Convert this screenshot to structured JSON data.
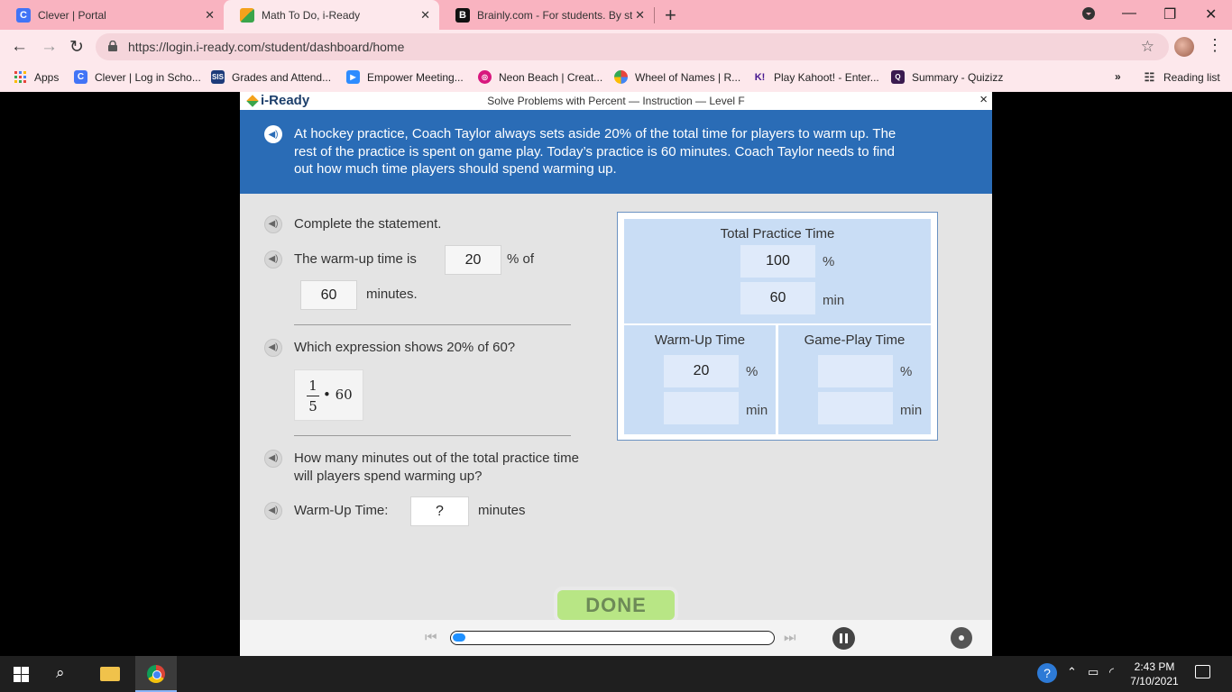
{
  "browser": {
    "tabs": [
      {
        "title": "Clever | Portal",
        "icon": "C",
        "color": "#4274f6"
      },
      {
        "title": "Math To Do, i-Ready",
        "icon": "iready-gem",
        "color": "#f4a21c"
      },
      {
        "title": "Brainly.com - For students. By stu",
        "icon": "B",
        "color": "#111111"
      }
    ],
    "url": "https://login.i-ready.com/student/dashboard/home",
    "bookmarks": [
      {
        "label": "Apps",
        "icon": "apps-grid"
      },
      {
        "label": "Clever | Log in Scho...",
        "icon": "C"
      },
      {
        "label": "Grades and Attend...",
        "icon": "SIS"
      },
      {
        "label": "Empower Meeting...",
        "icon": "video"
      },
      {
        "label": "Neon Beach | Creat...",
        "icon": "neon"
      },
      {
        "label": "Wheel of Names | R...",
        "icon": "wheel"
      },
      {
        "label": "Play Kahoot! - Enter...",
        "icon": "K!"
      },
      {
        "label": "Summary - Quizizz",
        "icon": "Q"
      }
    ],
    "reading_list": "Reading list"
  },
  "app": {
    "logo": "i-Ready",
    "lesson_title": "Solve Problems with Percent — Instruction — Level F",
    "close": "×",
    "problem": "At hockey practice, Coach Taylor always sets aside 20% of the total time for players to warm up. The rest of the practice is spent on game play. Today’s practice is 60 minutes. Coach Taylor needs to find out how much time players should spend warming up.",
    "complete_prompt": "Complete the statement.",
    "statement_pre": "The warm-up time is",
    "statement_val1": "20",
    "statement_mid": "% of",
    "statement_val2": "60",
    "statement_post": "minutes.",
    "expr_question": "Which expression shows 20% of 60?",
    "expr_num": "1",
    "expr_den": "5",
    "expr_rest": "• 60",
    "minutes_question": "How many minutes out of the total practice time will players spend warming up?",
    "warmup_label": "Warm-Up Time:",
    "warmup_value": "?",
    "warmup_unit": "minutes",
    "diagram": {
      "total_title": "Total Practice Time",
      "total_pct": "100",
      "total_min": "60",
      "warmup_title": "Warm-Up Time",
      "warmup_pct": "20",
      "warmup_min": "",
      "game_title": "Game-Play Time",
      "game_pct": "",
      "game_min": "",
      "pct_unit": "%",
      "min_unit": "min"
    },
    "done": "DONE",
    "progress": 0.04
  },
  "taskbar": {
    "time": "2:43 PM",
    "date": "7/10/2021"
  }
}
